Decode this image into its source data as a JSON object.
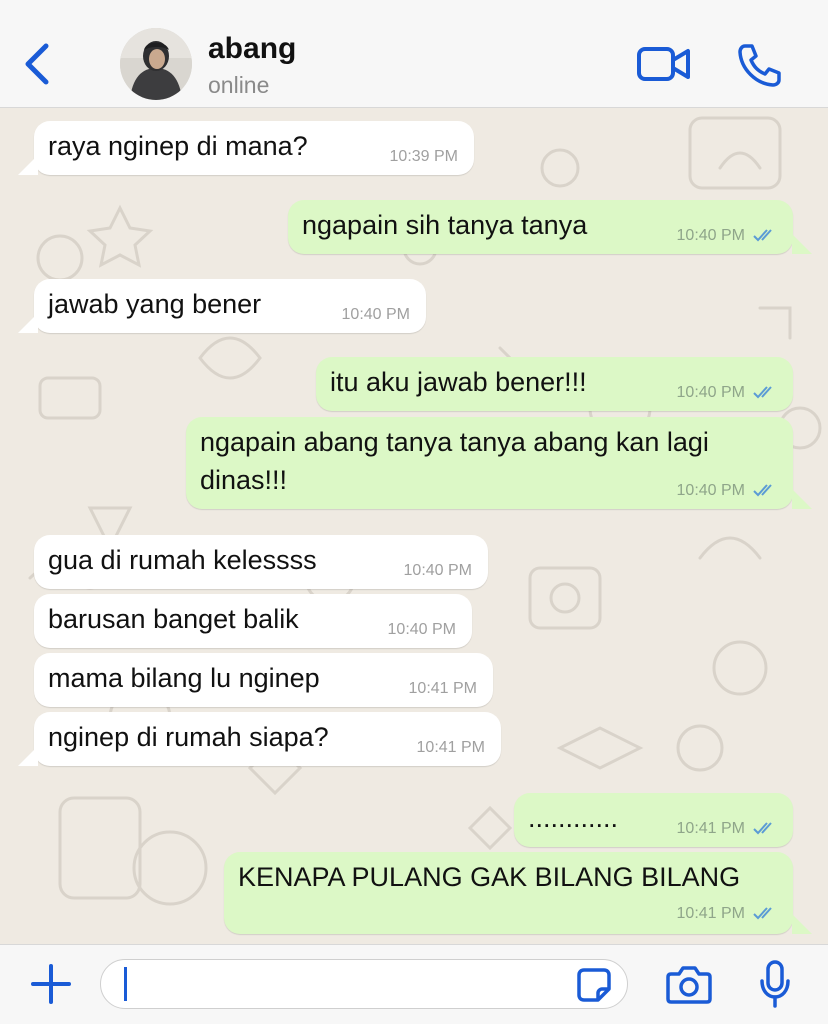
{
  "header": {
    "contact_name": "abang",
    "status": "online",
    "back_icon": "chevron-left-icon",
    "video_icon": "video-call-icon",
    "call_icon": "phone-icon"
  },
  "colors": {
    "accent": "#1a5bd6",
    "incoming_bubble": "#ffffff",
    "outgoing_bubble": "#dcf8c6",
    "wallpaper": "#efeae2",
    "read_ticks": "#5b9bd5"
  },
  "messages": [
    {
      "direction": "in",
      "text": "raya nginep di mana?",
      "time": "10:39 PM"
    },
    {
      "direction": "out",
      "text": "ngapain sih tanya tanya",
      "time": "10:40 PM",
      "status": "read"
    },
    {
      "direction": "in",
      "text": "jawab yang bener",
      "time": "10:40 PM"
    },
    {
      "direction": "out",
      "text": "itu aku jawab bener!!!",
      "time": "10:40 PM",
      "status": "read"
    },
    {
      "direction": "out",
      "text": "ngapain abang tanya tanya abang kan lagi dinas!!!",
      "time": "10:40 PM",
      "status": "read"
    },
    {
      "direction": "in",
      "text": "gua di rumah kelessss",
      "time": "10:40 PM"
    },
    {
      "direction": "in",
      "text": "barusan banget balik",
      "time": "10:40 PM"
    },
    {
      "direction": "in",
      "text": "mama bilang lu nginep",
      "time": "10:41 PM"
    },
    {
      "direction": "in",
      "text": "nginep di rumah siapa?",
      "time": "10:41 PM"
    },
    {
      "direction": "out",
      "text": "............",
      "time": "10:41 PM",
      "status": "read"
    },
    {
      "direction": "out",
      "text": "KENAPA PULANG GAK BILANG BILANG",
      "time": "10:41 PM",
      "status": "read"
    }
  ],
  "composer": {
    "value": "",
    "placeholder": "",
    "plus_icon": "plus-icon",
    "sticker_icon": "sticker-icon",
    "camera_icon": "camera-icon",
    "mic_icon": "microphone-icon"
  }
}
